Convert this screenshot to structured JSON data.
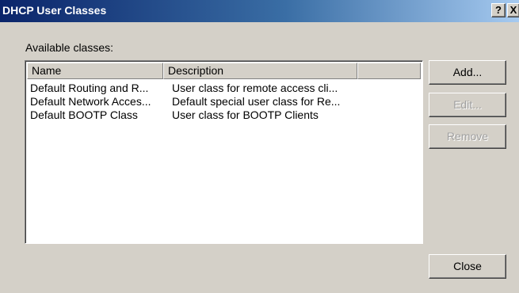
{
  "window": {
    "title": "DHCP User Classes",
    "help_glyph": "?",
    "close_glyph": "X"
  },
  "classes_label": "Available classes:",
  "list": {
    "columns": [
      "Name",
      "Description",
      ""
    ],
    "rows": [
      {
        "name": "Default Routing and R...",
        "description": "User class for remote access cli..."
      },
      {
        "name": "Default Network Acces...",
        "description": "Default special user class for Re..."
      },
      {
        "name": "Default BOOTP Class",
        "description": "User class for BOOTP Clients"
      }
    ]
  },
  "buttons": {
    "add": "Add...",
    "edit": "Edit...",
    "remove": "Remove",
    "close": "Close"
  },
  "colors": {
    "titlebar_start": "#0a246a",
    "titlebar_end": "#a6caf0",
    "face": "#d4d0c8",
    "disabled_text": "#a0a0a0"
  }
}
